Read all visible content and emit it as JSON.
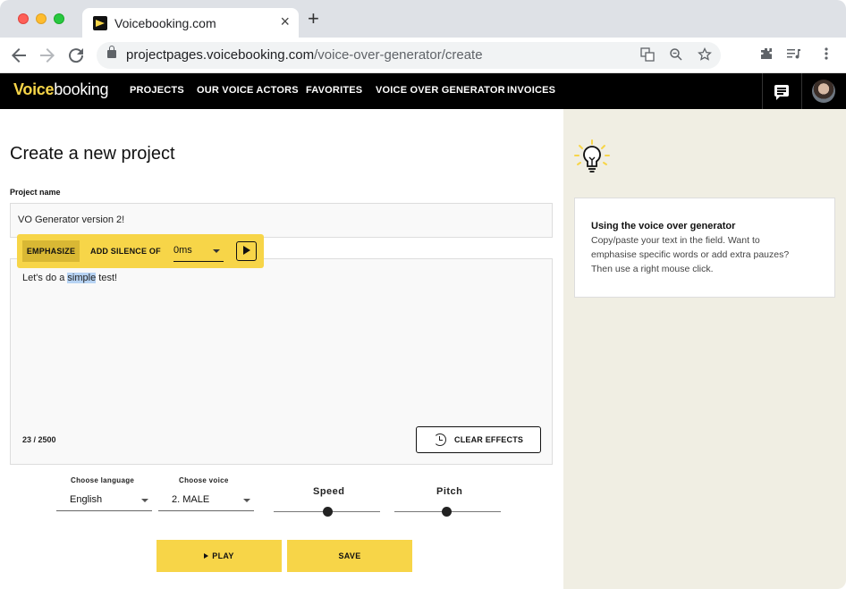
{
  "browser": {
    "tab_title": "Voicebooking.com",
    "new_tab_symbol": "+",
    "close_symbol": "×",
    "url_host": "projectpages.voicebooking.com",
    "url_path": "/voice-over-generator/create"
  },
  "site": {
    "logo_part1": "Voice",
    "logo_part2": "booking",
    "nav": [
      "PROJECTS",
      "OUR VOICE ACTORS",
      "FAVORITES",
      "VOICE OVER GENERATOR",
      "INVOICES"
    ]
  },
  "page": {
    "title": "Create a new project",
    "project_name_label": "Project name",
    "project_name_value": "VO Generator version 2!"
  },
  "effects_toolbar": {
    "emphasize_label": "EMPHASIZE",
    "silence_label": "ADD SILENCE OF",
    "silence_value": "0ms"
  },
  "editor": {
    "text_before": "Let's do a ",
    "text_highlight": "simple",
    "text_after": " test!",
    "counter": "23 / 2500",
    "clear_label": "CLEAR EFFECTS"
  },
  "controls": {
    "language_label": "Choose language",
    "language_value": "English",
    "voice_label": "Choose voice",
    "voice_value": "2. MALE",
    "speed_label": "Speed",
    "speed_value": 0.5,
    "pitch_label": "Pitch",
    "pitch_value": 0.5,
    "play_label": "PLAY",
    "save_label": "SAVE"
  },
  "sidebar": {
    "info_title": "Using the voice over generator",
    "info_lines": [
      "Copy/paste your text in the field. Want to",
      "emphasise specific words or add extra pauzes?",
      "Then use a right mouse click."
    ]
  },
  "colors": {
    "brand_yellow": "#f7d548",
    "header_bg": "#000000",
    "sidebar_bg": "#f0eee3"
  }
}
